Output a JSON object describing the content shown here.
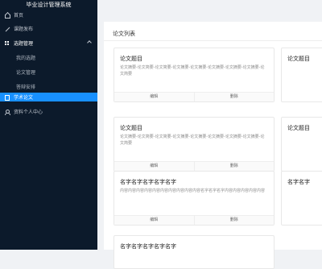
{
  "app": {
    "title": "毕业设计管理系统"
  },
  "sidebar": {
    "items": [
      {
        "label": "首页",
        "icon": "home-icon"
      },
      {
        "label": "课题发布",
        "icon": "pen-icon"
      },
      {
        "label": "选题管理",
        "icon": "grid-icon"
      },
      {
        "label": "我的选题"
      },
      {
        "label": "论文管理"
      },
      {
        "label": "答辩安排"
      },
      {
        "label": "学术论文",
        "icon": "document-icon"
      },
      {
        "label": "资料个人中心",
        "icon": "person-icon"
      }
    ]
  },
  "main": {
    "title": "论文列表",
    "cards": [
      {
        "title": "论文题目",
        "desc": "论文摘要-论文简要-论文简要-论文摘要-论文摘要-论文摘要-论文摘要-论文摘要-论文简要",
        "edit": "编辑",
        "delete": "删除"
      },
      {
        "title": "论文题目",
        "desc": "论文摘要-论文简要-论文简要-论文摘要-论文摘要-论文摘要-论文摘要-论文摘要-论文简要",
        "edit": "编辑",
        "delete": "删除"
      },
      {
        "title": "名字名字名字名字名字",
        "desc": "内容内容内容内容内容内容内容内容内容内容名字名字名字内容内容内容内容内容",
        "edit": "编辑",
        "delete": "删除"
      },
      {
        "title": "名字名字名字名字名字"
      }
    ],
    "right_cards": [
      {
        "title": "论文题目"
      },
      {
        "title": "论文题目"
      },
      {
        "title": "名字名字"
      }
    ]
  },
  "colors": {
    "sidebar": "#0c1a2b",
    "accent": "#1890ff",
    "background": "#f0f2f5"
  }
}
